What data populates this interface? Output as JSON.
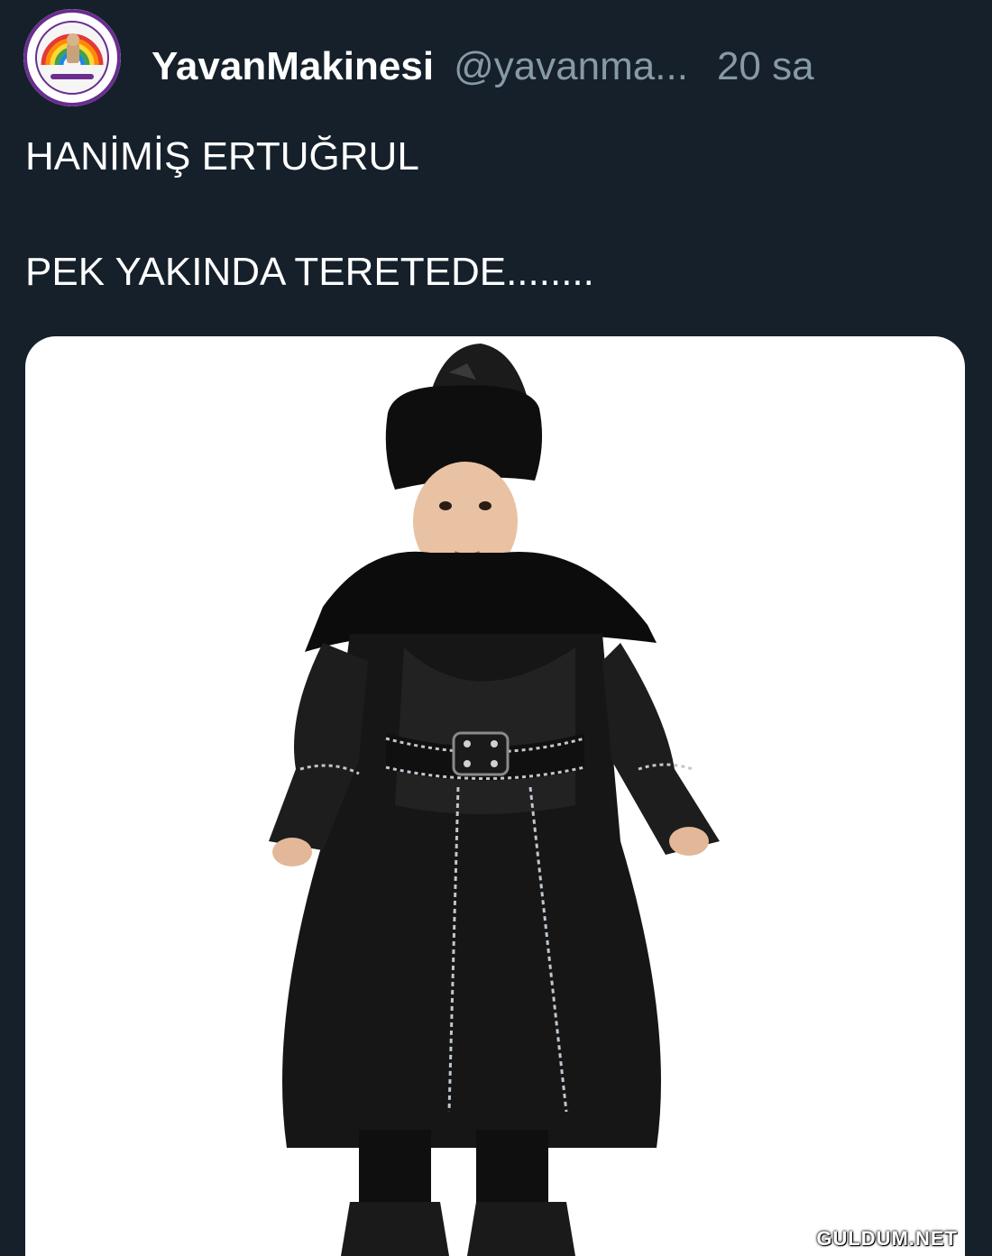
{
  "tweet": {
    "display_name": "YavanMakinesi",
    "handle": "@yavanma...",
    "timestamp": "20 sa",
    "text_lines": [
      "HANİMİŞ ERTUĞRUL",
      "PEK YAKINDA TERETEDE........"
    ]
  },
  "media": {
    "description_icon": "photo",
    "watermark": "GULDUM.NET"
  },
  "colors": {
    "background": "#15202b",
    "text_primary": "#ffffff",
    "text_secondary": "#8899a6",
    "media_background": "#ffffff"
  }
}
